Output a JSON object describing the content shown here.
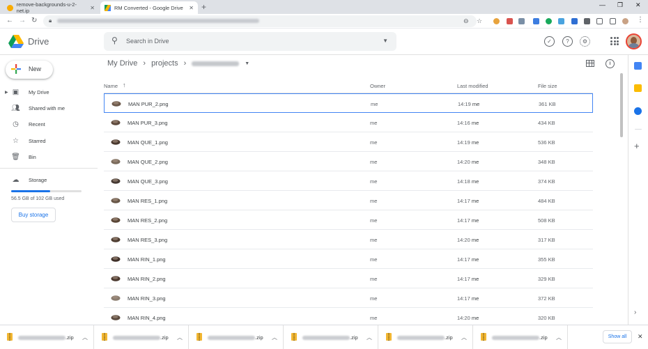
{
  "browser": {
    "tabs": [
      {
        "title": "remove-backgrounds-u-2-net.ip"
      },
      {
        "title": "RM Converted - Google Drive"
      }
    ],
    "close_symbol": "✕",
    "new_tab_symbol": "+",
    "window_controls": [
      "—",
      "❐",
      "✕"
    ]
  },
  "drive": {
    "brand": "Drive",
    "search_placeholder": "Search in Drive",
    "new_label": "New",
    "nav": [
      {
        "label": "My Drive",
        "icon": "my-drive-icon"
      },
      {
        "label": "Shared with me",
        "icon": "shared-icon"
      },
      {
        "label": "Recent",
        "icon": "clock-icon"
      },
      {
        "label": "Starred",
        "icon": "star-icon"
      },
      {
        "label": "Bin",
        "icon": "trash-icon"
      }
    ],
    "storage_label": "Storage",
    "storage_used_text": "56.5 GB of 102 GB used",
    "storage_fraction": 0.554,
    "buy_storage": "Buy storage",
    "breadcrumb": {
      "root": "My Drive",
      "folder": "projects"
    },
    "columns": {
      "name": "Name",
      "owner": "Owner",
      "modified": "Last modified",
      "size": "File size"
    },
    "files": [
      {
        "name": "MAN PUR_2.png",
        "owner": "me",
        "time": "14:19",
        "by": "me",
        "size": "361 KB"
      },
      {
        "name": "MAN PUR_3.png",
        "owner": "me",
        "time": "14:16",
        "by": "me",
        "size": "434 KB"
      },
      {
        "name": "MAN QUE_1.png",
        "owner": "me",
        "time": "14:19",
        "by": "me",
        "size": "536 KB"
      },
      {
        "name": "MAN QUE_2.png",
        "owner": "me",
        "time": "14:20",
        "by": "me",
        "size": "348 KB"
      },
      {
        "name": "MAN QUE_3.png",
        "owner": "me",
        "time": "14:18",
        "by": "me",
        "size": "374 KB"
      },
      {
        "name": "MAN RES_1.png",
        "owner": "me",
        "time": "14:17",
        "by": "me",
        "size": "484 KB"
      },
      {
        "name": "MAN RES_2.png",
        "owner": "me",
        "time": "14:17",
        "by": "me",
        "size": "508 KB"
      },
      {
        "name": "MAN RES_3.png",
        "owner": "me",
        "time": "14:20",
        "by": "me",
        "size": "317 KB"
      },
      {
        "name": "MAN RIN_1.png",
        "owner": "me",
        "time": "14:17",
        "by": "me",
        "size": "355 KB"
      },
      {
        "name": "MAN RIN_2.png",
        "owner": "me",
        "time": "14:17",
        "by": "me",
        "size": "329 KB"
      },
      {
        "name": "MAN RIN_3.png",
        "owner": "me",
        "time": "14:17",
        "by": "me",
        "size": "372 KB"
      },
      {
        "name": "MAN RIN_4.png",
        "owner": "me",
        "time": "14:20",
        "by": "me",
        "size": "320 KB"
      }
    ]
  },
  "downloads": {
    "items": [
      {
        "suffix": ".zip"
      },
      {
        "suffix": ".zip"
      },
      {
        "suffix": ".zip"
      },
      {
        "suffix": ".zip"
      },
      {
        "suffix": ".zip"
      },
      {
        "suffix": ".zip"
      }
    ],
    "show_all": "Show all"
  },
  "colors": {
    "accent": "#1a73e8",
    "selected_border": "#4285f4"
  }
}
